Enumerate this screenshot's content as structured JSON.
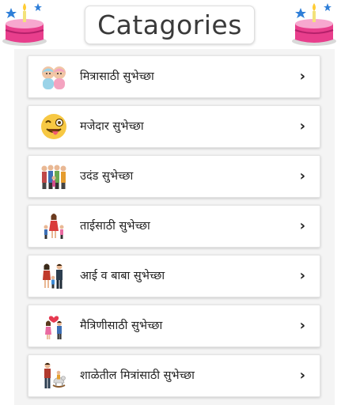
{
  "header": {
    "title": "Catagories"
  },
  "categories": [
    {
      "label": "मित्रासाठी सुभेच्छा",
      "icon": "twins-babies-icon"
    },
    {
      "label": "मजेदार सुभेच्छा",
      "icon": "winking-tongue-emoji-icon"
    },
    {
      "label": "उदंड सुभेच्छा",
      "icon": "family-group-icon"
    },
    {
      "label": "ताईसाठी सुभेच्छा",
      "icon": "sister-children-icon"
    },
    {
      "label": "आई व बाबा सुभेच्छा",
      "icon": "parents-child-icon"
    },
    {
      "label": "मैत्रिणीसाठी सुभेच्छा",
      "icon": "couple-heart-icon"
    },
    {
      "label": "शाळेतील मित्रांसाठी सुभेच्छा",
      "icon": "father-child-horse-icon"
    }
  ],
  "chevron": "›"
}
